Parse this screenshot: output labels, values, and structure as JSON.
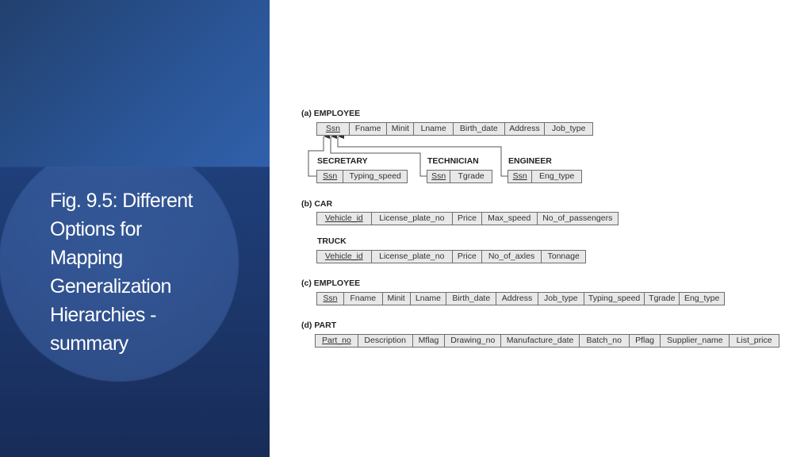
{
  "slide": {
    "title_lines": [
      "Fig. 9.5: Different",
      "Options for",
      "Mapping",
      "Generalization",
      "Hierarchies -",
      "summary"
    ]
  },
  "diagram": {
    "sections": [
      {
        "label": "(a) EMPLOYEE",
        "relations": [
          {
            "name": "",
            "attributes": [
              "Ssn",
              "Fname",
              "Minit",
              "Lname",
              "Birth_date",
              "Address",
              "Job_type"
            ],
            "key": "Ssn"
          },
          {
            "name": "SECRETARY",
            "attributes": [
              "Ssn",
              "Typing_speed"
            ],
            "key": "Ssn"
          },
          {
            "name": "TECHNICIAN",
            "attributes": [
              "Ssn",
              "Tgrade"
            ],
            "key": "Ssn"
          },
          {
            "name": "ENGINEER",
            "attributes": [
              "Ssn",
              "Eng_type"
            ],
            "key": "Ssn"
          }
        ]
      },
      {
        "label": "(b) CAR",
        "relations": [
          {
            "name": "",
            "attributes": [
              "Vehicle_id",
              "License_plate_no",
              "Price",
              "Max_speed",
              "No_of_passengers"
            ],
            "key": "Vehicle_id"
          },
          {
            "name": "TRUCK",
            "attributes": [
              "Vehicle_id",
              "License_plate_no",
              "Price",
              "No_of_axles",
              "Tonnage"
            ],
            "key": "Vehicle_id"
          }
        ]
      },
      {
        "label": "(c) EMPLOYEE",
        "relations": [
          {
            "name": "",
            "attributes": [
              "Ssn",
              "Fname",
              "Minit",
              "Lname",
              "Birth_date",
              "Address",
              "Job_type",
              "Typing_speed",
              "Tgrade",
              "Eng_type"
            ],
            "key": "Ssn"
          }
        ]
      },
      {
        "label": "(d) PART",
        "relations": [
          {
            "name": "",
            "attributes": [
              "Part_no",
              "Description",
              "Mflag",
              "Drawing_no",
              "Manufacture_date",
              "Batch_no",
              "Pflag",
              "Supplier_name",
              "List_price"
            ],
            "key": "Part_no"
          }
        ]
      }
    ]
  }
}
